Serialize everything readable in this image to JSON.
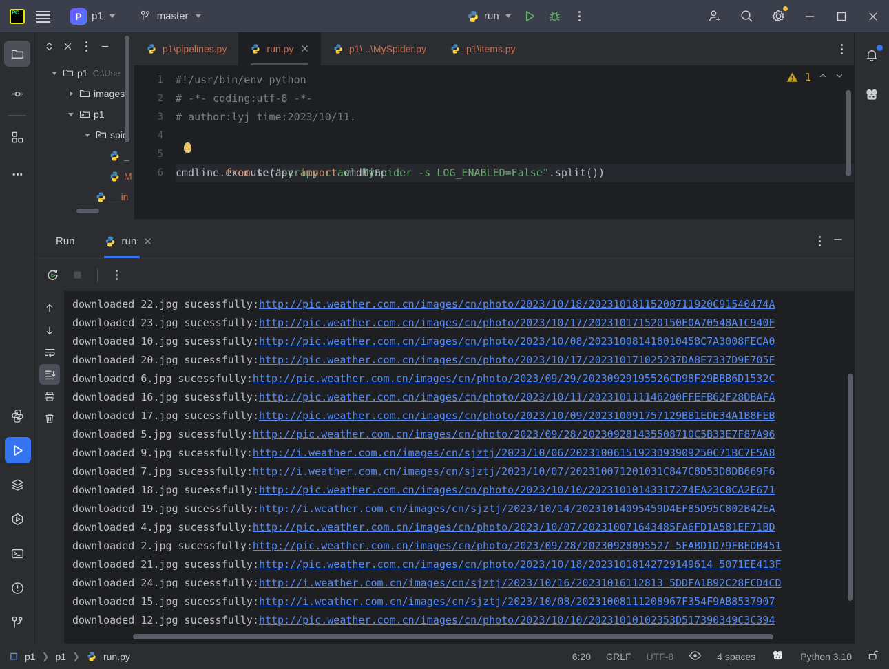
{
  "titlebar": {
    "app_icon": "pycharm-logo-icon",
    "menu_icon": "hamburger-menu-icon",
    "project_badge": "P",
    "project_name": "p1",
    "vcs_icon": "git-branch-icon",
    "vcs_branch": "master",
    "run_config_icon": "python-icon",
    "run_config_name": "run",
    "run_button": "run-icon",
    "debug_button": "debug-bug-icon",
    "more_button": "more-vertical-icon",
    "share_button": "add-user-icon",
    "search_button": "search-icon",
    "settings_button": "gear-icon",
    "minimize": "minimize-icon",
    "maximize": "maximize-icon",
    "close": "close-icon"
  },
  "leftbar": {
    "items": [
      {
        "name": "project-tool-window",
        "icon": "folder-icon",
        "active": true
      },
      {
        "name": "commit-tool-window",
        "icon": "commit-node-icon",
        "active": false
      },
      {
        "name": "structure-tool-window",
        "icon": "blocks-icon",
        "active": false
      },
      {
        "name": "more-tool-windows",
        "icon": "more-horizontal-icon",
        "active": false
      }
    ],
    "bottom_items": [
      {
        "name": "python-packages-tool-window",
        "icon": "python-icon",
        "active": false
      },
      {
        "name": "run-tool-window",
        "icon": "play-icon",
        "active": true
      },
      {
        "name": "services-tool-window",
        "icon": "layers-icon",
        "active": false
      },
      {
        "name": "python-console-tool-window",
        "icon": "hexagon-play-icon",
        "active": false
      },
      {
        "name": "terminal-tool-window",
        "icon": "terminal-icon",
        "active": false
      },
      {
        "name": "problems-tool-window",
        "icon": "warning-circle-icon",
        "active": false
      },
      {
        "name": "version-control-tool-window",
        "icon": "git-branch-icon",
        "active": false
      }
    ]
  },
  "rightbar": {
    "items": [
      {
        "name": "notifications",
        "icon": "bell-icon",
        "badge": true
      },
      {
        "name": "ai-assistant",
        "icon": "ai-assistant-icon",
        "badge": false
      }
    ]
  },
  "project_panel": {
    "toolbar": [
      {
        "name": "expand-collapse-button",
        "icon": "chevron-up-down-icon"
      },
      {
        "name": "collapse-all-button",
        "icon": "collapse-all-icon"
      },
      {
        "name": "options-button",
        "icon": "more-vertical-icon"
      },
      {
        "name": "hide-button",
        "icon": "minimize-icon"
      }
    ],
    "tree": [
      {
        "label": "p1",
        "path": "C:\\Use",
        "icon": "folder-icon",
        "expanded": true,
        "indent": 0
      },
      {
        "label": "images",
        "path": "",
        "icon": "folder-icon",
        "expanded": false,
        "indent": 1
      },
      {
        "label": "p1",
        "path": "",
        "icon": "module-folder-icon",
        "expanded": true,
        "indent": 1
      },
      {
        "label": "spid",
        "path": "",
        "icon": "module-folder-icon",
        "expanded": true,
        "indent": 2
      },
      {
        "label": "_",
        "path": "",
        "icon": "python-file-icon",
        "expanded": null,
        "indent": 3
      },
      {
        "label": "M",
        "path": "",
        "icon": "python-file-icon",
        "expanded": null,
        "indent": 3
      },
      {
        "label": "__in",
        "path": "",
        "icon": "python-file-icon",
        "expanded": null,
        "indent": 2
      }
    ]
  },
  "editor": {
    "tabs": [
      {
        "label": "p1\\pipelines.py",
        "icon": "python-file-icon",
        "active": false,
        "closable": false
      },
      {
        "label": "run.py",
        "icon": "python-file-icon",
        "active": true,
        "closable": true
      },
      {
        "label": "p1\\...\\MySpider.py",
        "icon": "python-file-icon",
        "active": false,
        "closable": false
      },
      {
        "label": "p1\\items.py",
        "icon": "python-file-icon",
        "active": false,
        "closable": false
      }
    ],
    "tabs_more_icon": "more-vertical-icon",
    "line_numbers": [
      "1",
      "2",
      "3",
      "4",
      "5",
      "6"
    ],
    "lines": [
      {
        "n": 1,
        "segments": [
          {
            "t": "#!/usr/bin/env python",
            "c": "cmt"
          }
        ]
      },
      {
        "n": 2,
        "segments": [
          {
            "t": "# -*- coding:utf-8 -*-",
            "c": "cmt"
          }
        ]
      },
      {
        "n": 3,
        "segments": [
          {
            "t": "# author:lyj time:2023/10/11.",
            "c": "cmt"
          }
        ]
      },
      {
        "n": 4,
        "segments": [
          {
            "t": "",
            "c": ""
          }
        ]
      },
      {
        "n": 5,
        "segments": [
          {
            "t": "from",
            "c": "kw"
          },
          {
            "t": " scrapy ",
            "c": ""
          },
          {
            "t": "import",
            "c": "kw"
          },
          {
            "t": " cmdline",
            "c": ""
          }
        ]
      },
      {
        "n": 6,
        "segments": [
          {
            "t": "cmdline.execute(",
            "c": ""
          },
          {
            "t": "\"scrapy crawl MySpider -s LOG_ENABLED=False\"",
            "c": "str"
          },
          {
            "t": ".split())",
            "c": ""
          }
        ]
      }
    ],
    "warning_icon": "warning-triangle-icon",
    "warning_count": "1",
    "prev_problem_icon": "chevron-up-icon",
    "next_problem_icon": "chevron-down-icon"
  },
  "run_panel": {
    "title": "Run",
    "tab_label": "run",
    "tab_icon": "python-icon",
    "tab_close_icon": "close-icon",
    "options_icon": "more-vertical-icon",
    "hide_icon": "minimize-icon",
    "toolbar": [
      {
        "name": "rerun-button",
        "icon": "rerun-icon"
      },
      {
        "name": "stop-button",
        "icon": "stop-square-icon"
      },
      {
        "name": "more-options-button",
        "icon": "more-vertical-icon"
      }
    ],
    "console_toolbar": [
      {
        "name": "scroll-up-button",
        "icon": "arrow-up-icon",
        "active": false
      },
      {
        "name": "scroll-down-button",
        "icon": "arrow-down-icon",
        "active": false
      },
      {
        "name": "soft-wrap-button",
        "icon": "soft-wrap-icon",
        "active": false
      },
      {
        "name": "scroll-to-end-button",
        "icon": "scroll-to-end-icon",
        "active": true
      },
      {
        "name": "print-button",
        "icon": "printer-icon",
        "active": false
      },
      {
        "name": "clear-all-button",
        "icon": "trash-icon",
        "active": false
      }
    ],
    "console_lines": [
      {
        "prefix": "downloaded 22.jpg sucessfully:",
        "url": "http://pic.weather.com.cn/images/cn/photo/2023/10/18/20231018115200711920C91540474A"
      },
      {
        "prefix": "downloaded 23.jpg sucessfully:",
        "url": "http://pic.weather.com.cn/images/cn/photo/2023/10/17/202310171520150E0A70548A1C940F"
      },
      {
        "prefix": "downloaded 10.jpg sucessfully:",
        "url": "http://pic.weather.com.cn/images/cn/photo/2023/10/08/202310081418010458C7A3008FECA0"
      },
      {
        "prefix": "downloaded 20.jpg sucessfully:",
        "url": "http://pic.weather.com.cn/images/cn/photo/2023/10/17/202310171025237DA8E7337D9E705F"
      },
      {
        "prefix": "downloaded 6.jpg sucessfully:",
        "url": "http://pic.weather.com.cn/images/cn/photo/2023/09/29/20230929195526CD98F29BBB6D1532C"
      },
      {
        "prefix": "downloaded 16.jpg sucessfully:",
        "url": "http://pic.weather.com.cn/images/cn/photo/2023/10/11/202310111146200FFEFB62F28DBAFA"
      },
      {
        "prefix": "downloaded 17.jpg sucessfully:",
        "url": "http://pic.weather.com.cn/images/cn/photo/2023/10/09/202310091757129BB1EDE34A1B8FEB"
      },
      {
        "prefix": "downloaded 5.jpg sucessfully:",
        "url": "http://pic.weather.com.cn/images/cn/photo/2023/09/28/202309281435508710C5B33E7F87A96"
      },
      {
        "prefix": "downloaded 9.jpg sucessfully:",
        "url": "http://i.weather.com.cn/images/cn/sjztj/2023/10/06/20231006151923D93909250C71BC7E5A8"
      },
      {
        "prefix": "downloaded 7.jpg sucessfully:",
        "url": "http://i.weather.com.cn/images/cn/sjztj/2023/10/07/202310071201031C847C8D53D8DB669F6"
      },
      {
        "prefix": "downloaded 18.jpg sucessfully:",
        "url": "http://pic.weather.com.cn/images/cn/photo/2023/10/10/20231010143317274EA23C8CA2E671"
      },
      {
        "prefix": "downloaded 19.jpg sucessfully:",
        "url": "http://i.weather.com.cn/images/cn/sjztj/2023/10/14/20231014095459D4EF85D95C802B42EA"
      },
      {
        "prefix": "downloaded 4.jpg sucessfully:",
        "url": "http://pic.weather.com.cn/images/cn/photo/2023/10/07/202310071643485FA6FD1A581EF71BD"
      },
      {
        "prefix": "downloaded 2.jpg sucessfully:",
        "url": "http://pic.weather.com.cn/images/cn/photo/2023/09/28/20230928095527 5FABD1D79FBEDB451"
      },
      {
        "prefix": "downloaded 21.jpg sucessfully:",
        "url": "http://pic.weather.com.cn/images/cn/photo/2023/10/18/20231018142729149614 5071EE413F"
      },
      {
        "prefix": "downloaded 24.jpg sucessfully:",
        "url": "http://i.weather.com.cn/images/cn/sjztj/2023/10/16/20231016112813 5DDFA1B92C28FCD4CD"
      },
      {
        "prefix": "downloaded 15.jpg sucessfully:",
        "url": "http://i.weather.com.cn/images/cn/sjztj/2023/10/08/20231008111208967F354F9AB8537907"
      },
      {
        "prefix": "downloaded 12.jpg sucessfully:",
        "url": "http://pic.weather.com.cn/images/cn/photo/2023/10/10/20231010102353D517390349C3C394"
      }
    ]
  },
  "statusbar": {
    "breadcrumb": [
      {
        "label": "p1",
        "icon": "project-icon"
      },
      {
        "label": "p1",
        "icon": ""
      },
      {
        "label": "run.py",
        "icon": "python-file-icon"
      }
    ],
    "caret_position": "6:20",
    "line_separator": "CRLF",
    "encoding": "UTF-8",
    "reader_mode_icon": "eye-icon",
    "indent": "4 spaces",
    "ai_icon": "ai-assistant-icon",
    "interpreter": "Python 3.10",
    "lock_icon": "unlocked-icon"
  },
  "colors": {
    "accent_blue": "#3574f0",
    "link_blue": "#548af7",
    "tab_text_red": "#cf6a4c",
    "string_green": "#6aab73",
    "keyword_orange": "#cf8e6d",
    "comment_grey": "#7a7e85",
    "warning_yellow": "#d9a343",
    "titlebar_bg": "#3a3f4b",
    "panel_bg": "#2b2d30",
    "editor_bg": "#1e1f22"
  }
}
